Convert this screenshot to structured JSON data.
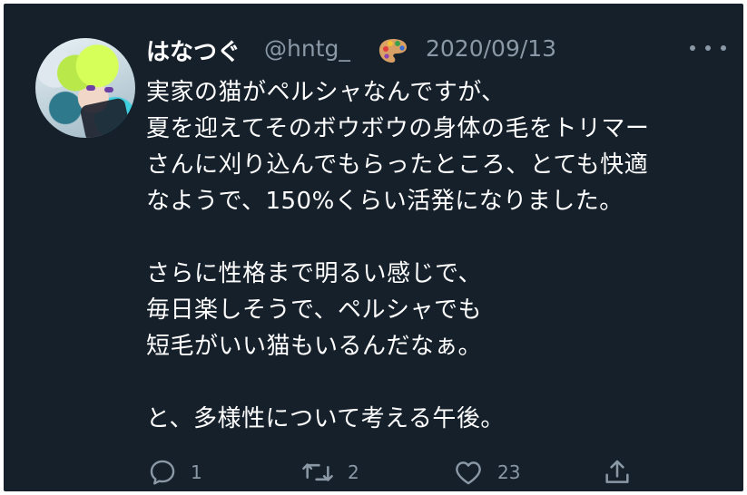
{
  "tweet": {
    "display_name": "はなつぐ",
    "handle": "@hntg_",
    "handle_emoji": "artist-palette",
    "date": "2020/09/13",
    "lines": [
      "実家の猫がペルシャなんですが、",
      "夏を迎えてそのボウボウの身体の毛をトリマー",
      "さんに刈り込んでもらったところ、とても快適",
      "なようで、150%くらい活発になりました。",
      "",
      "さらに性格まで明るい感じで、",
      "毎日楽しそうで、ペルシャでも",
      "短毛がいい猫もいるんだなぁ。",
      "",
      "と、多様性について考える午後。"
    ]
  },
  "actions": {
    "reply_count": "1",
    "retweet_count": "2",
    "like_count": "23"
  },
  "icons": {
    "reply": "reply-icon",
    "retweet": "retweet-icon",
    "like": "like-icon",
    "share": "share-icon",
    "more": "more-options-icon"
  },
  "colors": {
    "background": "#15202b",
    "text": "#ffffff",
    "secondary": "#8b98a5"
  }
}
